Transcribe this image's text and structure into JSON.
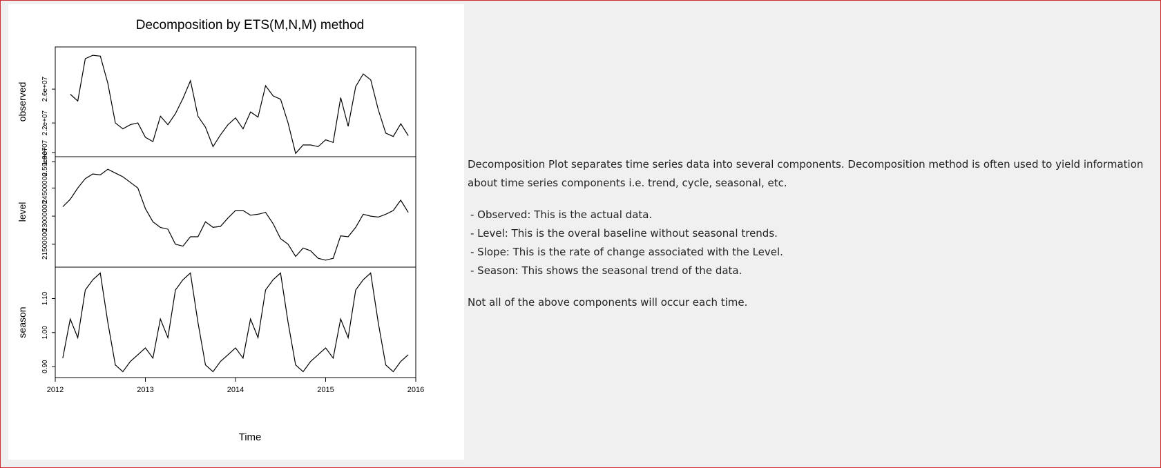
{
  "chart_data": {
    "type": "line",
    "title": "Decomposition by ETS(M,N,M) method",
    "xlabel": "Time",
    "x_ticks": [
      "2012",
      "2013",
      "2014",
      "2015",
      "2016"
    ],
    "xlim": [
      2012,
      2016
    ],
    "panels": [
      {
        "name": "observed",
        "ylabel": "observed",
        "ylim": [
          18500000,
          30500000
        ],
        "y_ticks": [
          {
            "value": 18500000,
            "label": "1.8e+07"
          },
          {
            "value": 22000000,
            "label": "2.2e+07"
          },
          {
            "value": 26000000,
            "label": "2.6e+07"
          }
        ],
        "start": 2012.1667,
        "values": [
          25400000,
          24600000,
          29600000,
          30000000,
          29900000,
          26700000,
          22000000,
          21300000,
          21800000,
          22000000,
          20300000,
          19800000,
          22800000,
          21800000,
          23100000,
          24900000,
          27000000,
          22800000,
          21500000,
          19200000,
          20600000,
          21800000,
          22600000,
          21300000,
          23300000,
          22700000,
          26400000,
          25200000,
          24800000,
          22000000,
          18400000,
          19400000,
          19400000,
          19200000,
          20000000,
          19700000,
          25000000,
          21600000,
          26300000,
          27800000,
          27100000,
          23600000,
          20800000,
          20400000,
          21900000,
          20500000
        ]
      },
      {
        "name": "level",
        "ylabel": "level",
        "ylim": [
          20500000,
          25950000
        ],
        "y_ticks": [
          {
            "value": 21500000,
            "label": "21500000"
          },
          {
            "value": 23000000,
            "label": "23000000"
          },
          {
            "value": 24500000,
            "label": "24500000"
          },
          {
            "value": 25900000,
            "label": "2.59e+07"
          }
        ],
        "start": 2012.0833,
        "values": [
          23500000,
          23900000,
          24500000,
          25000000,
          25250000,
          25200000,
          25500000,
          25300000,
          25100000,
          24800000,
          24500000,
          23400000,
          22700000,
          22400000,
          22300000,
          21500000,
          21400000,
          21900000,
          21900000,
          22700000,
          22400000,
          22450000,
          22900000,
          23300000,
          23300000,
          23050000,
          23100000,
          23200000,
          22600000,
          21800000,
          21500000,
          20850000,
          21300000,
          21150000,
          20750000,
          20650000,
          20750000,
          21950000,
          21900000,
          22400000,
          23100000,
          23000000,
          22950000,
          23100000,
          23300000,
          23850000,
          23200000
        ]
      },
      {
        "name": "season",
        "ylabel": "season",
        "ylim": [
          0.88,
          1.18
        ],
        "y_ticks": [
          {
            "value": 0.9,
            "label": "0.90"
          },
          {
            "value": 1.0,
            "label": "1.00"
          },
          {
            "value": 1.1,
            "label": "1.10"
          }
        ],
        "start": 2012.0833,
        "values": [
          0.925,
          1.04,
          0.985,
          1.125,
          1.155,
          1.175,
          1.03,
          0.905,
          0.885,
          0.915,
          0.935,
          0.955,
          0.925,
          1.04,
          0.985,
          1.125,
          1.155,
          1.175,
          1.03,
          0.905,
          0.885,
          0.915,
          0.935,
          0.955,
          0.925,
          1.04,
          0.985,
          1.125,
          1.155,
          1.175,
          1.03,
          0.905,
          0.885,
          0.915,
          0.935,
          0.955,
          0.925,
          1.04,
          0.985,
          1.125,
          1.155,
          1.175,
          1.03,
          0.905,
          0.885,
          0.915,
          0.935
        ]
      }
    ],
    "colors": {
      "line": "#000000",
      "background": "#ffffff"
    }
  },
  "description": {
    "intro": "Decomposition Plot separates time series data into several components. Decomposition method is often used to yield information about time series components i.e. trend, cycle, seasonal, etc.",
    "items": [
      "- Observed: This is the actual data.",
      "- Level: This is the overal baseline without seasonal trends.",
      "- Slope: This is the rate of change associated with the Level.",
      "- Season: This shows the seasonal trend of the data."
    ],
    "note": "Not all of the above components will occur each time."
  }
}
